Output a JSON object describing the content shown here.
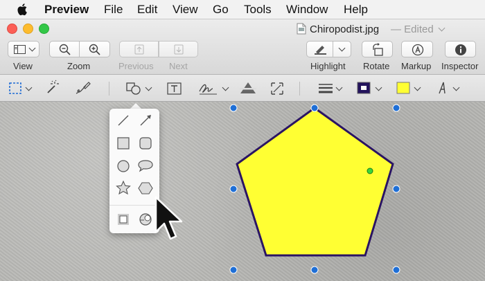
{
  "menubar": {
    "apple_icon": "apple-icon",
    "app_name": "Preview",
    "items": [
      "File",
      "Edit",
      "View",
      "Go",
      "Tools",
      "Window",
      "Help"
    ]
  },
  "window": {
    "filename": "Chiropodist.jpg",
    "status": "— Edited"
  },
  "toolbar": {
    "view_label": "View",
    "zoom_label": "Zoom",
    "previous_label": "Previous",
    "next_label": "Next",
    "highlight_label": "Highlight",
    "rotate_label": "Rotate",
    "markup_label": "Markup",
    "inspector_label": "Inspector"
  },
  "markup_tools": [
    "rect-selection-icon",
    "instant-alpha-icon",
    "sketch-icon",
    "shapes-icon",
    "text-icon",
    "sign-icon",
    "adjust-color-icon",
    "adjust-size-icon",
    "shape-style-icon",
    "border-color-icon",
    "fill-color-icon",
    "text-style-icon"
  ],
  "colors": {
    "border_color": "#23135c",
    "fill_color": "#ffff33",
    "pentagon_fill": "#ffff33",
    "pentagon_stroke": "#2a1463",
    "handle": "#1f6fd6",
    "green_handle": "#3bd63b"
  },
  "shapes_popup": {
    "items": [
      "line-icon",
      "arrow-icon",
      "rectangle-icon",
      "rounded-rectangle-icon",
      "oval-icon",
      "speech-bubble-icon",
      "star-icon",
      "polygon-icon",
      "mask-icon",
      "loupe-icon"
    ]
  }
}
